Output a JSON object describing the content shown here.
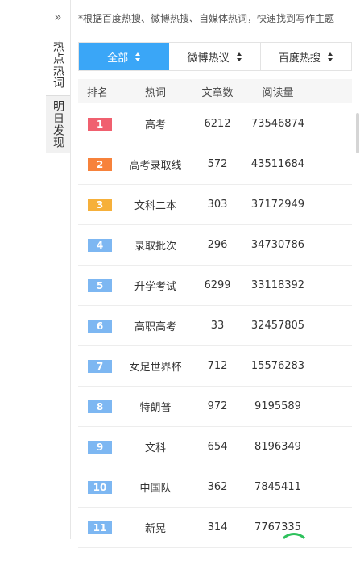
{
  "sidebar": {
    "tabs": [
      {
        "label": "热点热词"
      },
      {
        "label": "明日发现"
      }
    ]
  },
  "note": "*根据百度热搜、微博热搜、自媒体热词，快速找到写作主题",
  "filters": [
    {
      "label": "全部"
    },
    {
      "label": "微博热议"
    },
    {
      "label": "百度热搜"
    }
  ],
  "table": {
    "headers": [
      "排名",
      "热词",
      "文章数",
      "阅读量"
    ],
    "rows": [
      {
        "rank": "1",
        "word": "高考",
        "articles": "6212",
        "reads": "73546874"
      },
      {
        "rank": "2",
        "word": "高考录取线",
        "articles": "572",
        "reads": "43511684"
      },
      {
        "rank": "3",
        "word": "文科二本",
        "articles": "303",
        "reads": "37172949"
      },
      {
        "rank": "4",
        "word": "录取批次",
        "articles": "296",
        "reads": "34730786"
      },
      {
        "rank": "5",
        "word": "升学考试",
        "articles": "6299",
        "reads": "33118392"
      },
      {
        "rank": "6",
        "word": "高职高考",
        "articles": "33",
        "reads": "32457805"
      },
      {
        "rank": "7",
        "word": "女足世界杯",
        "articles": "712",
        "reads": "15576283"
      },
      {
        "rank": "8",
        "word": "特朗普",
        "articles": "972",
        "reads": "9195589"
      },
      {
        "rank": "9",
        "word": "文科",
        "articles": "654",
        "reads": "8196349"
      },
      {
        "rank": "10",
        "word": "中国队",
        "articles": "362",
        "reads": "7845411"
      },
      {
        "rank": "11",
        "word": "新晃",
        "articles": "314",
        "reads": "7767335"
      }
    ]
  },
  "colors": {
    "accent": "#3aa6f7",
    "rank1": "#f0606f",
    "rank2": "#f7823b",
    "rank3": "#f6b03a",
    "rank_other": "#7db7f2"
  },
  "icons": {
    "expand": "double-chevron-right-icon",
    "sort": "sort-icon"
  }
}
